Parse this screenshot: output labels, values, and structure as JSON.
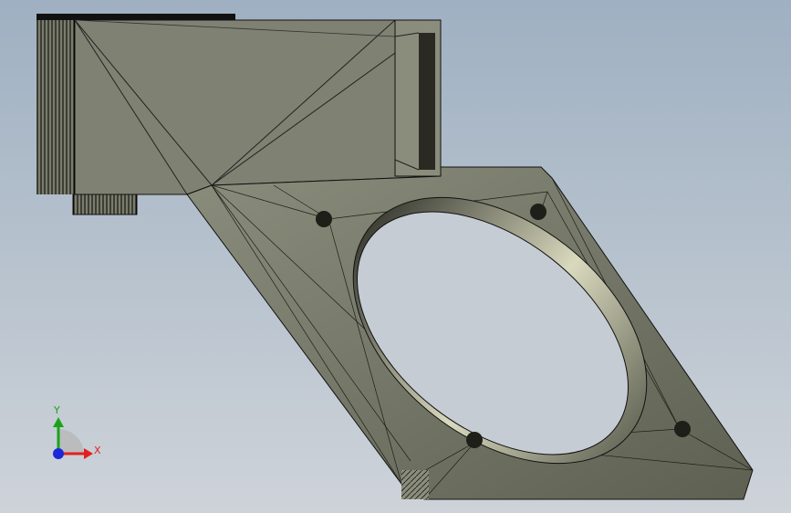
{
  "viewport": {
    "background_top": "#9fb0c2",
    "background_bottom": "#ced3d9"
  },
  "model": {
    "face_color": "#7f8272",
    "edge_color": "#000000",
    "hole_wall_color": "#d8d8c0"
  },
  "triad": {
    "x_label": "X",
    "y_label": "Y",
    "x_color": "#e32020",
    "y_color": "#1aa31a",
    "z_color": "#1c28d8"
  }
}
